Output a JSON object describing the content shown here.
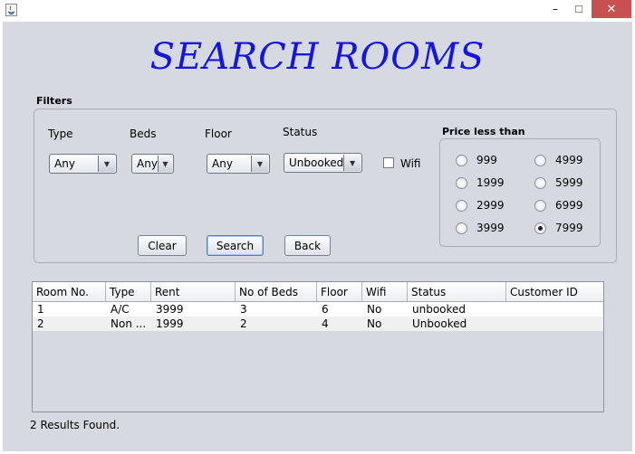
{
  "window": {
    "close_symbol": "✕",
    "maximize_symbol": "☐",
    "minimize_symbol": "–"
  },
  "title": "SEARCH ROOMS",
  "filters": {
    "label": "Filters",
    "type": {
      "label": "Type",
      "value": "Any"
    },
    "beds": {
      "label": "Beds",
      "value": "Any"
    },
    "floor": {
      "label": "Floor",
      "value": "Any"
    },
    "status": {
      "label": "Status",
      "value": "Unbooked"
    },
    "wifi": {
      "label": "Wifi",
      "checked": false
    }
  },
  "price": {
    "title": "Price less than",
    "options": [
      "999",
      "4999",
      "1999",
      "5999",
      "2999",
      "6999",
      "3999",
      "7999"
    ],
    "selected": "7999"
  },
  "buttons": {
    "clear": "Clear",
    "search": "Search",
    "back": "Back"
  },
  "table": {
    "columns": [
      "Room No.",
      "Type",
      "Rent",
      "No of Beds",
      "Floor",
      "Wifi",
      "Status",
      "Customer ID"
    ],
    "rows": [
      [
        "1",
        "A/C",
        "3999",
        "3",
        "6",
        "No",
        "unbooked",
        ""
      ],
      [
        "2",
        "Non ...",
        "1999",
        "2",
        "4",
        "No",
        "Unbooked",
        ""
      ]
    ]
  },
  "status_text": "2 Results Found."
}
